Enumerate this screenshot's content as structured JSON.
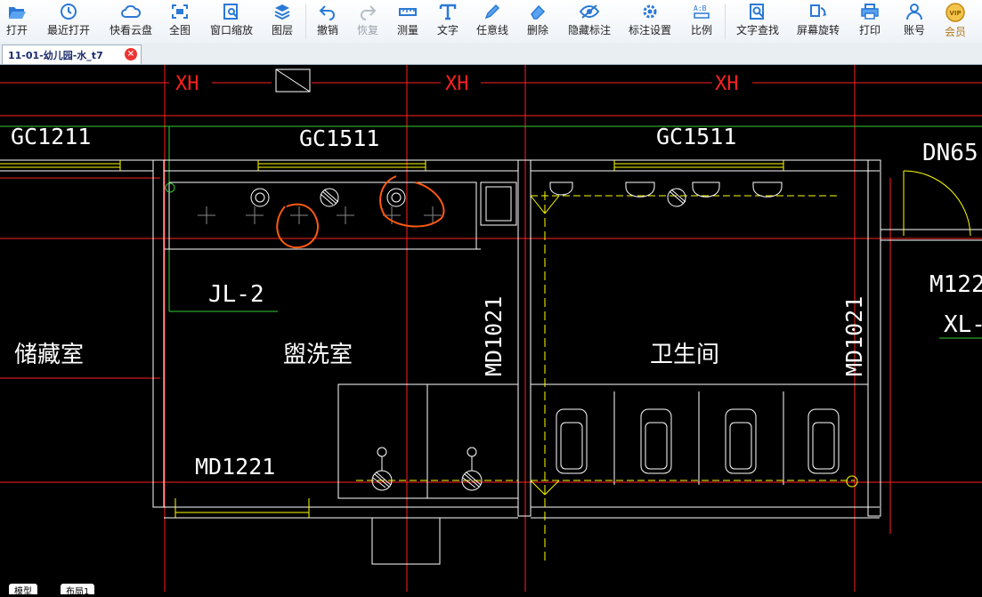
{
  "toolbar": {
    "items": [
      {
        "label": "打开",
        "icon": "folder-open-icon"
      },
      {
        "label": "最近打开",
        "icon": "recent-clock-icon"
      },
      {
        "label": "快看云盘",
        "icon": "cloud-icon"
      },
      {
        "label": "全图",
        "icon": "fit-all-icon"
      },
      {
        "label": "窗口缩放",
        "icon": "zoom-window-icon"
      },
      {
        "label": "图层",
        "icon": "layers-icon"
      },
      {
        "label": "撤销",
        "icon": "undo-icon"
      },
      {
        "label": "恢复",
        "icon": "redo-icon"
      },
      {
        "label": "测量",
        "icon": "ruler-icon"
      },
      {
        "label": "文字",
        "icon": "text-tool-icon"
      },
      {
        "label": "任意线",
        "icon": "pen-icon"
      },
      {
        "label": "删除",
        "icon": "eraser-icon"
      },
      {
        "label": "隐藏标注",
        "icon": "hide-eye-icon"
      },
      {
        "label": "标注设置",
        "icon": "settings-icon"
      },
      {
        "label": "比例",
        "icon": "scale-icon"
      },
      {
        "label": "文字查找",
        "icon": "text-search-icon"
      },
      {
        "label": "屏幕旋转",
        "icon": "rotate-screen-icon"
      },
      {
        "label": "打印",
        "icon": "printer-icon"
      },
      {
        "label": "账号",
        "icon": "user-icon"
      },
      {
        "label": "会员",
        "icon": "vip-badge-icon"
      }
    ]
  },
  "tab": {
    "title": "11-01-幼儿园-水_t7",
    "close": "×"
  },
  "drawing": {
    "axis_labels": [
      "XH",
      "XH",
      "XH"
    ],
    "window_labels": [
      "GC1211",
      "GC1511",
      "GC1511"
    ],
    "pipe_label": "DN65",
    "pipe_tag": "JL-2",
    "room_storage": "储藏室",
    "room_washroom": "盥洗室",
    "room_toilet": "卫生间",
    "door_left": "MD1021",
    "door_right": "MD1021",
    "door_bottom": "MD1221",
    "right_label_1": "M122",
    "right_label_2": "XL-"
  },
  "layout_tabs": [
    "模型",
    "布局1"
  ],
  "colors": {
    "background": "#000000",
    "wall": "#ffffff",
    "axis_red": "#ff2020",
    "fixture_yellow": "#ffff00",
    "annotation_orange": "#ff5a10",
    "green_leader": "#33cc33"
  }
}
